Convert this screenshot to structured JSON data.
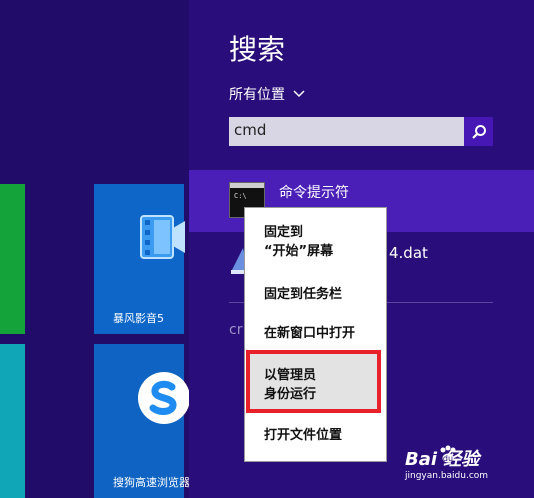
{
  "start_screen": {
    "tiles": [
      {
        "label": "暴风影音5",
        "color": "#0d66c8"
      },
      {
        "label": "搜狗高速浏览器",
        "color": "#0e63c3"
      }
    ],
    "tile_colors": {
      "green": "#14a33b",
      "teal": "#11a5b8"
    }
  },
  "search_pane": {
    "title": "搜索",
    "scope_label": "所有位置",
    "scope_icon": "chevron-down-icon",
    "search_value": "cmd",
    "search_icon": "magnifier-icon",
    "results": [
      {
        "label": "命令提示符",
        "icon": "cmd-window-icon",
        "selected": true
      },
      {
        "label": "4.dat",
        "icon": "file-icon",
        "selected": false
      }
    ],
    "truncated_text": "cr",
    "accent_color": "#4617b4",
    "background_color": "#290d7b"
  },
  "context_menu": {
    "items": [
      {
        "label_line1": "固定到",
        "label_line2": "“开始”屏幕"
      },
      {
        "label_line1": "固定到任务栏"
      },
      {
        "label_line1": "在新窗口中打开"
      },
      {
        "label_line1": "以管理员",
        "label_line2": "身份运行",
        "highlighted": true
      },
      {
        "label_line1": "打开文件位置"
      }
    ],
    "highlight_color": "#e8202a"
  },
  "watermark": {
    "brand": "Bai  经验",
    "url": "jingyan.baidu.com"
  }
}
